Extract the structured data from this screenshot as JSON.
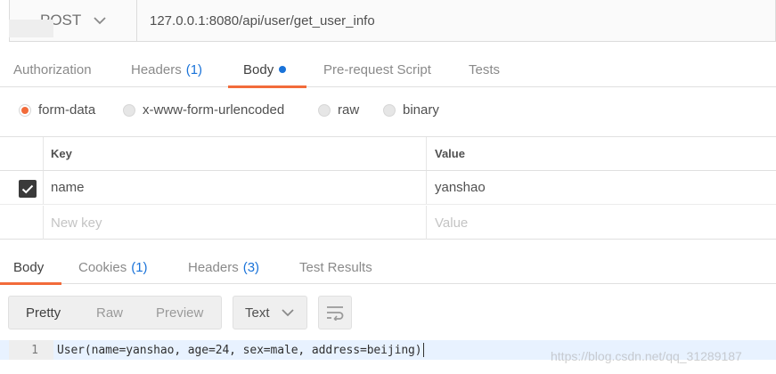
{
  "request": {
    "method": "POST",
    "url": "127.0.0.1:8080/api/user/get_user_info"
  },
  "request_tabs": [
    {
      "label": "Authorization",
      "count": ""
    },
    {
      "label": "Headers",
      "count": "(1)"
    },
    {
      "label": "Body",
      "count": ""
    },
    {
      "label": "Pre-request Script",
      "count": ""
    },
    {
      "label": "Tests",
      "count": ""
    }
  ],
  "body_types": [
    {
      "label": "form-data",
      "selected": true
    },
    {
      "label": "x-www-form-urlencoded",
      "selected": false
    },
    {
      "label": "raw",
      "selected": false
    },
    {
      "label": "binary",
      "selected": false
    }
  ],
  "params": {
    "headers": {
      "key": "Key",
      "value": "Value"
    },
    "rows": [
      {
        "key": "name",
        "value": "yanshao",
        "checked": true
      }
    ],
    "new_row": {
      "key_placeholder": "New key",
      "value_placeholder": "Value"
    }
  },
  "response_tabs": [
    {
      "label": "Body",
      "count": ""
    },
    {
      "label": "Cookies",
      "count": "(1)"
    },
    {
      "label": "Headers",
      "count": "(3)"
    },
    {
      "label": "Test Results",
      "count": ""
    }
  ],
  "view_modes": [
    "Pretty",
    "Raw",
    "Preview"
  ],
  "format": "Text",
  "response": {
    "line_number": "1",
    "line": "User(name=yanshao, age=24, sex=male, address=beijing)"
  },
  "watermark": "https://blog.csdn.net/qq_31289187",
  "colors": {
    "accent": "#f26b3a",
    "link": "#1a73d9"
  },
  "icons": {
    "chevron": "chevron-down-icon",
    "check": "check-icon",
    "wrap": "wrap-lines-icon"
  }
}
